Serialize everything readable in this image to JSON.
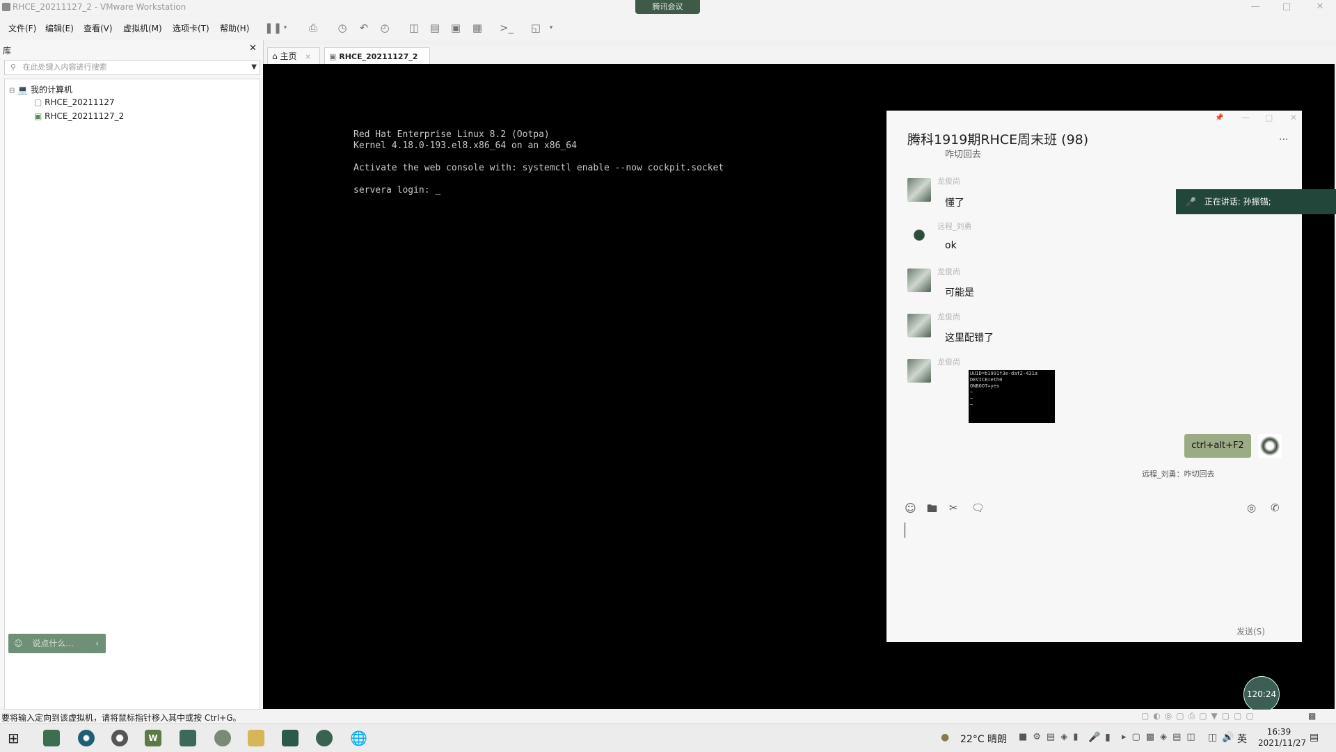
{
  "window": {
    "title": "RHCE_20211127_2 - VMware Workstation",
    "meeting_badge": "腾讯会议",
    "minimize": "—",
    "maximize": "□",
    "close": "✕"
  },
  "menu": [
    "文件(F)",
    "编辑(E)",
    "查看(V)",
    "虚拟机(M)",
    "选项卡(T)",
    "帮助(H)"
  ],
  "library": {
    "header": "库",
    "close": "✕",
    "search_placeholder": "在此处键入内容进行搜索",
    "root": "我的计算机",
    "vms": [
      "RHCE_20211127",
      "RHCE_20211127_2"
    ],
    "say_placeholder": "说点什么..."
  },
  "tabs": [
    {
      "label": "主页",
      "close": "✕"
    },
    {
      "label": "RHCE_20211127_2",
      "close": "✕"
    }
  ],
  "console": {
    "lines": [
      "Red Hat Enterprise Linux 8.2 (Ootpa)",
      "Kernel 4.18.0-193.el8.x86_64 on an x86_64",
      "",
      "Activate the web console with: systemctl enable --now cockpit.socket",
      "",
      "servera login: _"
    ]
  },
  "chat": {
    "title": "腾科1919期RHCE周末班 (98)",
    "more": "···",
    "partial_top": "咋切回去",
    "messages": [
      {
        "name": "龙俊尚",
        "text": "懂了"
      },
      {
        "name": "远程_刘勇",
        "text": "ok"
      },
      {
        "name": "龙俊尚",
        "text": "可能是"
      },
      {
        "name": "龙俊尚",
        "text": "这里配错了"
      },
      {
        "name": "龙俊尚",
        "text": ""
      }
    ],
    "image_lines": [
      "UUID=b1991f3e-daf2-431a",
      "DEVICE=eth0",
      "ONBOOT=yes",
      "~",
      "~",
      "~"
    ],
    "self_message": "ctrl+alt+F2",
    "quote": "远程_刘勇：咋切回去",
    "send_label": "发送(S)"
  },
  "speaking": "正在讲话: 孙振锚;",
  "timer": "120:24",
  "status_text": "要将输入定向到该虚拟机，请将鼠标指针移入其中或按 Ctrl+G。",
  "taskbar": {
    "weather": "22°C  晴朗",
    "ime": "英",
    "time": "16:39",
    "date": "2021/11/27"
  }
}
